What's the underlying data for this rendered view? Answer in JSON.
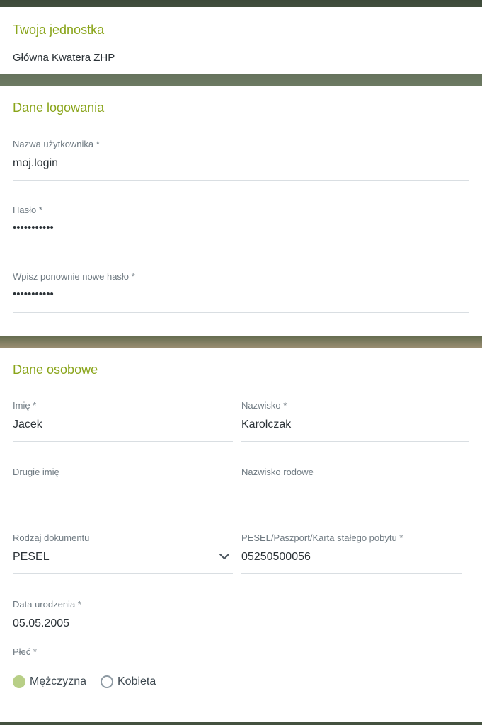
{
  "unit_section": {
    "title": "Twoja jednostka",
    "unit_name": "Główna Kwatera ZHP"
  },
  "login_section": {
    "title": "Dane logowania",
    "username": {
      "label": "Nazwa użytkownika *",
      "value": "moj.login"
    },
    "password": {
      "label": "Hasło *",
      "value": "•••••••••••"
    },
    "password_repeat": {
      "label": "Wpisz ponownie nowe hasło *",
      "value": "•••••••••••"
    }
  },
  "personal_section": {
    "title": "Dane osobowe",
    "first_name": {
      "label": "Imię *",
      "value": "Jacek"
    },
    "last_name": {
      "label": "Nazwisko *",
      "value": "Karolczak"
    },
    "second_name": {
      "label": "Drugie imię",
      "value": ""
    },
    "maiden_name": {
      "label": "Nazwisko rodowe",
      "value": ""
    },
    "document_type": {
      "label": "Rodzaj dokumentu",
      "value": "PESEL",
      "icon": "chevron-down-icon"
    },
    "document_number": {
      "label": "PESEL/Paszport/Karta stałego pobytu *",
      "value": "05250500056"
    },
    "birth_date": {
      "label": "Data urodzenia *",
      "value": "05.05.2005"
    },
    "gender": {
      "label": "Płeć *",
      "options": [
        {
          "label": "Mężczyzna",
          "selected": true
        },
        {
          "label": "Kobieta",
          "selected": false
        }
      ]
    }
  },
  "colors": {
    "accent": "#8aa51b",
    "radio_checked": "#b8cf87",
    "label": "#6f7a82",
    "text": "#2c3338",
    "divider": "#d9dee2"
  }
}
